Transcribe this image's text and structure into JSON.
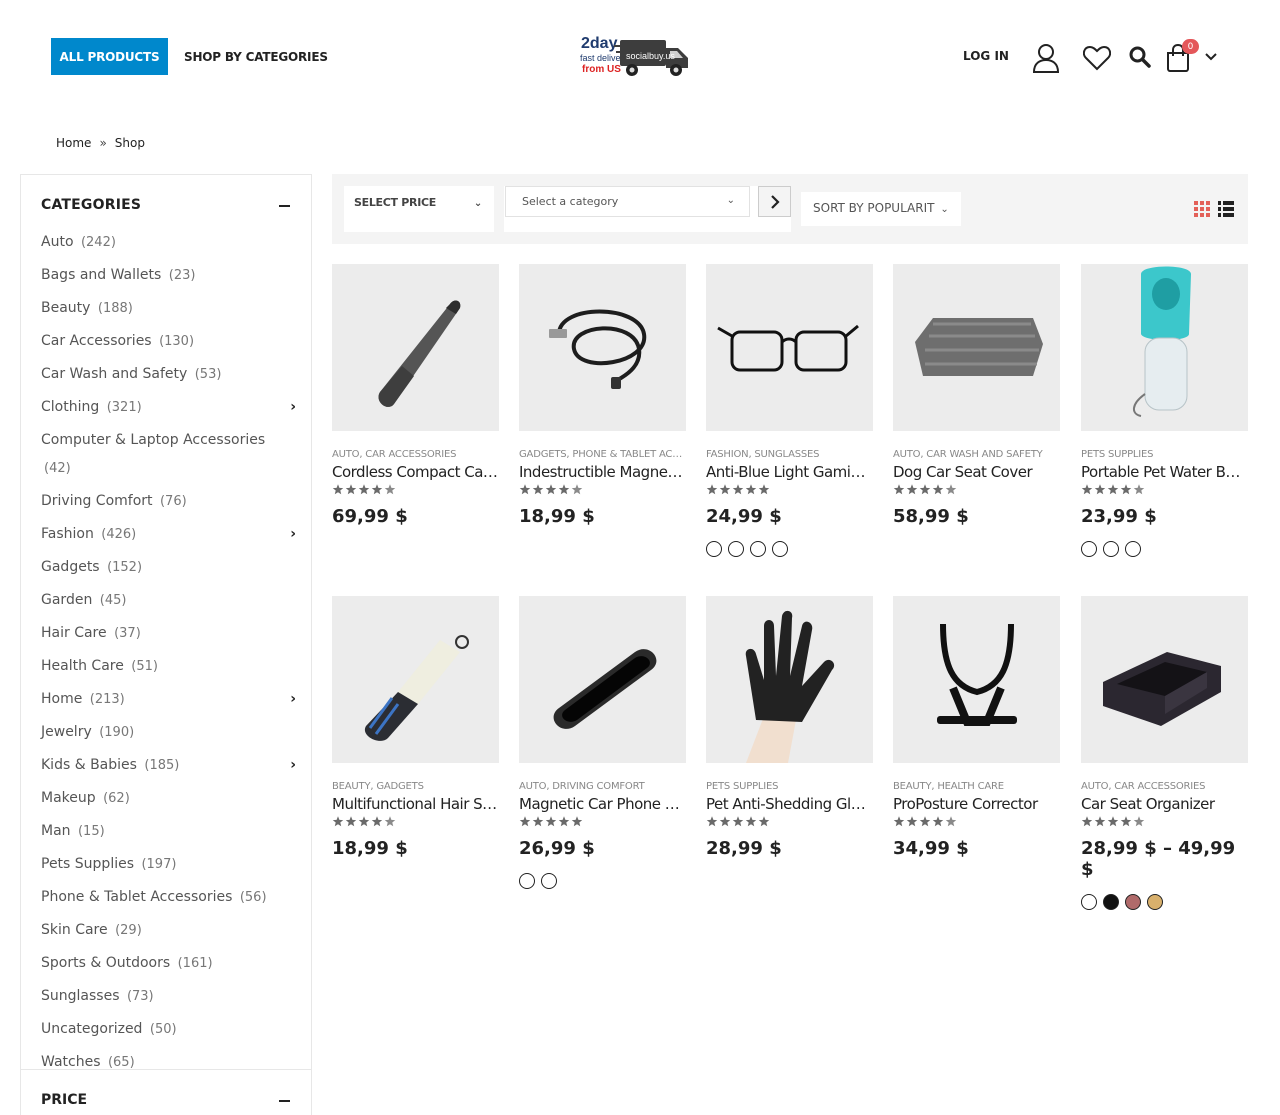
{
  "header": {
    "all_products": "ALL PRODUCTS",
    "shop_by_categories": "SHOP BY CATEGORIES",
    "logo": {
      "line1": "2day",
      "line2": "fast delivery",
      "line3": "from US",
      "truck_text": "socialbuy.us"
    },
    "login": "LOG IN",
    "cart_count": "0",
    "accent": "#0088cc"
  },
  "breadcrumb": {
    "home": "Home",
    "separator": "»",
    "current": "Shop"
  },
  "sidebar": {
    "categories_title": "CATEGORIES",
    "categories": [
      {
        "name": "Auto",
        "count": "(242)",
        "expandable": false
      },
      {
        "name": "Bags and Wallets",
        "count": "(23)",
        "expandable": false
      },
      {
        "name": "Beauty",
        "count": "(188)",
        "expandable": false
      },
      {
        "name": "Car Accessories",
        "count": "(130)",
        "expandable": false
      },
      {
        "name": "Car Wash and Safety",
        "count": "(53)",
        "expandable": false
      },
      {
        "name": "Clothing",
        "count": "(321)",
        "expandable": true
      },
      {
        "name": "Computer & Laptop Accessories",
        "count": "(42)",
        "expandable": false
      },
      {
        "name": "Driving Comfort",
        "count": "(76)",
        "expandable": false
      },
      {
        "name": "Fashion",
        "count": "(426)",
        "expandable": true
      },
      {
        "name": "Gadgets",
        "count": "(152)",
        "expandable": false
      },
      {
        "name": "Garden",
        "count": "(45)",
        "expandable": false
      },
      {
        "name": "Hair Care",
        "count": "(37)",
        "expandable": false
      },
      {
        "name": "Health Care",
        "count": "(51)",
        "expandable": false
      },
      {
        "name": "Home",
        "count": "(213)",
        "expandable": true
      },
      {
        "name": "Jewelry",
        "count": "(190)",
        "expandable": false
      },
      {
        "name": "Kids & Babies",
        "count": "(185)",
        "expandable": true
      },
      {
        "name": "Makeup",
        "count": "(62)",
        "expandable": false
      },
      {
        "name": "Man",
        "count": "(15)",
        "expandable": false
      },
      {
        "name": "Pets Supplies",
        "count": "(197)",
        "expandable": false
      },
      {
        "name": "Phone & Tablet Accessories",
        "count": "(56)",
        "expandable": false
      },
      {
        "name": "Skin Care",
        "count": "(29)",
        "expandable": false
      },
      {
        "name": "Sports & Outdoors",
        "count": "(161)",
        "expandable": false
      },
      {
        "name": "Sunglasses",
        "count": "(73)",
        "expandable": false
      },
      {
        "name": "Uncategorized",
        "count": "(50)",
        "expandable": false
      },
      {
        "name": "Watches",
        "count": "(65)",
        "expandable": false
      }
    ],
    "price_title": "PRICE"
  },
  "toolbar": {
    "select_price": "SELECT PRICE",
    "select_category_placeholder": "Select a category",
    "sort_by": "SORT BY POPULARIT"
  },
  "products": [
    {
      "cats": "AUTO, CAR ACCESSORIES",
      "title": "Cordless Compact Car Vacuum",
      "rating": 4.5,
      "price": "69,99 $",
      "swatches": [],
      "image": "vacuum"
    },
    {
      "cats": "GADGETS, PHONE & TABLET ACCESSORIES",
      "title": "Indestructible Magnetic Cable",
      "rating": 4.5,
      "price": "18,99 $",
      "swatches": [],
      "image": "cable"
    },
    {
      "cats": "FASHION, SUNGLASSES",
      "title": "Anti-Blue Light Gaming Glasses",
      "rating": 5,
      "price": "24,99 $",
      "swatches": [
        "#ffffff",
        "#ffffff",
        "#ffffff",
        "#ffffff"
      ],
      "image": "glasses"
    },
    {
      "cats": "AUTO, CAR WASH AND SAFETY",
      "title": "Dog Car Seat Cover",
      "rating": 4.5,
      "price": "58,99 $",
      "swatches": [],
      "image": "seatcover"
    },
    {
      "cats": "PETS SUPPLIES",
      "title": "Portable Pet Water Bottle",
      "rating": 4.5,
      "price": "23,99 $",
      "swatches": [
        "#ffffff",
        "#ffffff",
        "#ffffff"
      ],
      "image": "bottle"
    },
    {
      "cats": "BEAUTY, GADGETS",
      "title": "Multifunctional Hair Styler",
      "rating": 4.5,
      "price": "18,99 $",
      "swatches": [],
      "image": "hairstyler"
    },
    {
      "cats": "AUTO, DRIVING COMFORT",
      "title": "Magnetic Car Phone Holder",
      "rating": 5,
      "price": "26,99 $",
      "swatches": [
        "#ffffff",
        "#ffffff"
      ],
      "image": "phoneholder"
    },
    {
      "cats": "PETS SUPPLIES",
      "title": "Pet Anti-Shedding Gloves",
      "rating": 5,
      "price": "28,99 $",
      "swatches": [],
      "image": "glove"
    },
    {
      "cats": "BEAUTY, HEALTH CARE",
      "title": "ProPosture Corrector",
      "rating": 4.5,
      "price": "34,99 $",
      "swatches": [],
      "image": "posture"
    },
    {
      "cats": "AUTO, CAR ACCESSORIES",
      "title": "Car Seat Organizer",
      "rating": 4.5,
      "price": "28,99 $ – 49,99 $",
      "swatches": [
        "#ffffff",
        "#111111",
        "#b06a6a",
        "#d8b06c"
      ],
      "image": "organizer"
    }
  ]
}
